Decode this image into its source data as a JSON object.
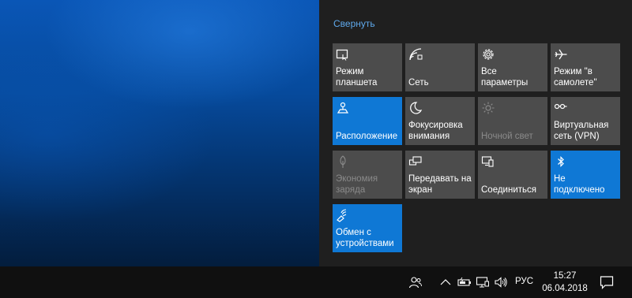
{
  "action_center": {
    "collapse_label": "Свернуть",
    "tiles": [
      {
        "label": "Режим планшета",
        "icon": "tablet-mode-icon",
        "state": "off"
      },
      {
        "label": "Сеть",
        "icon": "network-icon",
        "state": "off"
      },
      {
        "label": "Все параметры",
        "icon": "gear-icon",
        "state": "off"
      },
      {
        "label": "Режим \"в самолете\"",
        "icon": "airplane-icon",
        "state": "off"
      },
      {
        "label": "Расположение",
        "icon": "location-icon",
        "state": "on"
      },
      {
        "label": "Фокусировка внимания",
        "icon": "moon-icon",
        "state": "off"
      },
      {
        "label": "Ночной свет",
        "icon": "brightness-icon",
        "state": "disabled"
      },
      {
        "label": "Виртуальная сеть (VPN)",
        "icon": "vpn-icon",
        "state": "off"
      },
      {
        "label": "Экономия заряда",
        "icon": "battery-saver-icon",
        "state": "disabled"
      },
      {
        "label": "Передавать на экран",
        "icon": "project-icon",
        "state": "off"
      },
      {
        "label": "Соединиться",
        "icon": "connect-icon",
        "state": "off"
      },
      {
        "label": "Не подключено",
        "icon": "bluetooth-icon",
        "state": "on"
      },
      {
        "label": "Обмен с устройствами",
        "icon": "nearby-sharing-icon",
        "state": "on"
      }
    ]
  },
  "taskbar": {
    "language": "РУС",
    "time": "15:27",
    "date": "06.04.2018",
    "tray_icons": [
      "people-icon",
      "chevron-up-icon",
      "battery-icon",
      "display-icon",
      "volume-icon"
    ],
    "notification_icon": "notification-icon"
  },
  "colors": {
    "accent": "#0f78d5",
    "tile_bg": "#4c4c4c",
    "panel_bg": "#1f1f1f",
    "taskbar_bg": "#101010",
    "link": "#5fa9ec"
  }
}
